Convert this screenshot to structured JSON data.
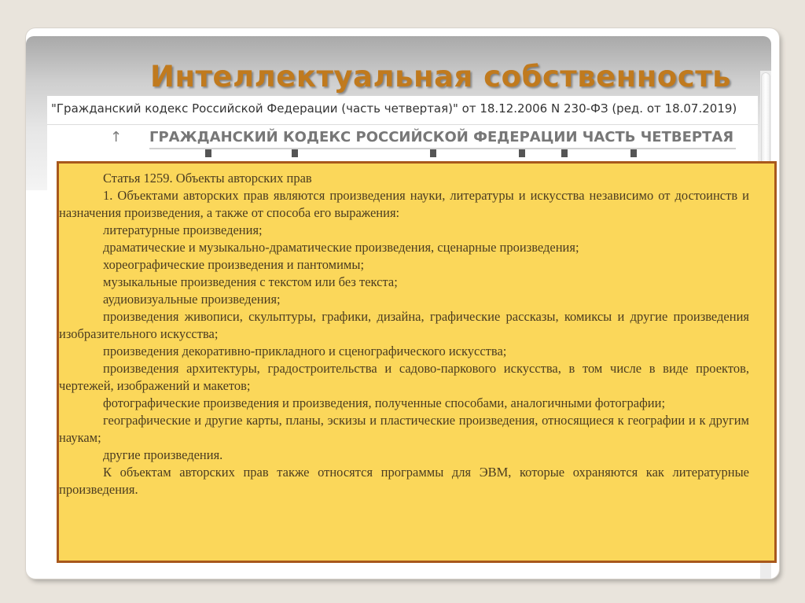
{
  "slide": {
    "title": "Интеллектуальная собственность"
  },
  "document": {
    "heading": "\"Гражданский кодекс Российской Федерации (часть четвертая)\" от 18.12.2006 N 230-ФЗ (ред. от 18.07.2019)",
    "chapter": "ГРАЖДАНСКИЙ КОДЕКС РОССИЙСКОЙ ФЕДЕРАЦИИ ЧАСТЬ ЧЕТВЕРТАЯ",
    "up_arrow": "↑"
  },
  "article": {
    "number": "Статья 1259.",
    "title": "Объекты авторских прав",
    "paragraphs": [
      "1. Объектами авторских прав являются произведения науки, литературы и искусства независимо от достоинств и назначения произведения, а также от способа его выражения:",
      "литературные произведения;",
      "драматические и музыкально-драматические произведения, сценарные произведения;",
      "хореографические произведения и пантомимы;",
      "музыкальные произведения с текстом или без текста;",
      "аудиовизуальные произведения;",
      "произведения живописи, скульптуры, графики, дизайна, графические рассказы, комиксы и другие произведения изобразительного искусства;",
      "произведения декоративно-прикладного и сценографического искусства;",
      "произведения архитектуры, градостроительства и садово-паркового искусства, в том числе в виде проектов, чертежей, изображений и макетов;",
      "фотографические произведения и произведения, полученные способами, аналогичными фотографии;",
      "географические и другие карты, планы, эскизы и пластические произведения, относящиеся к географии и к другим наукам;",
      "другие произведения.",
      "К объектам авторских прав также относятся программы для ЭВМ, которые охраняются как литературные произведения."
    ]
  },
  "colors": {
    "background": "#e9e4dc",
    "title": "#c07a1e",
    "panel_fill": "#fbd75a",
    "panel_border": "#a8581c",
    "panel_text": "#4b3c21"
  }
}
